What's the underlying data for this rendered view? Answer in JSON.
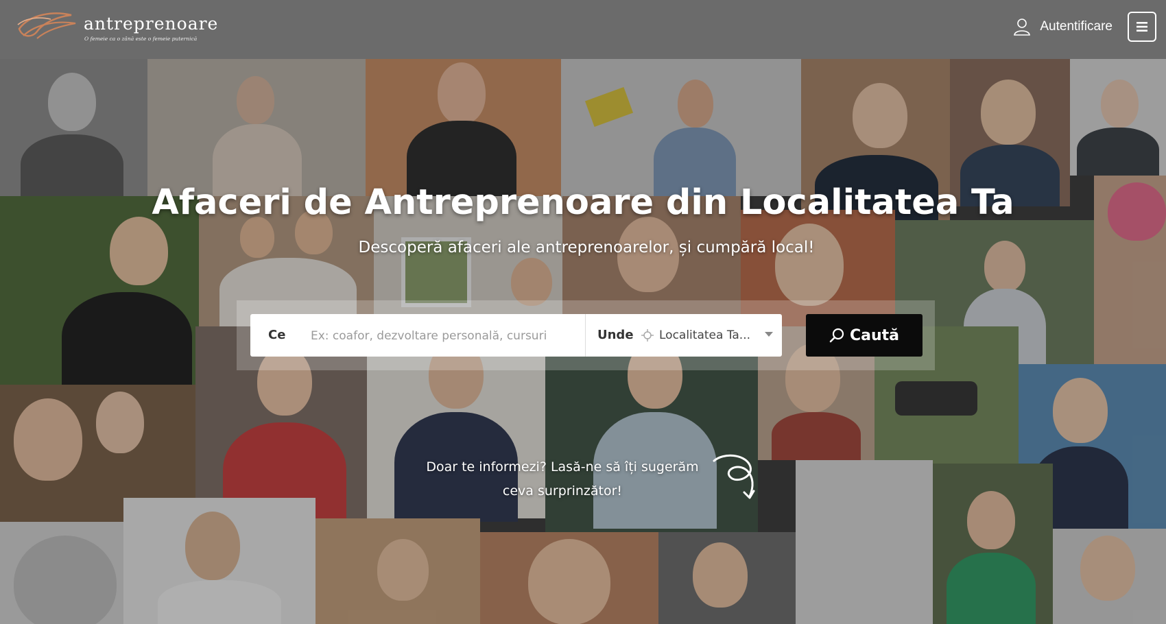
{
  "header": {
    "logo_text": "antreprenoare",
    "logo_tagline": "O femeie ca o zână este o femeie puternică",
    "login_label": "Autentificare"
  },
  "hero": {
    "title": "Afaceri de Antreprenoare din Localitatea Ta",
    "subtitle": "Descoperă afaceri ale antreprenoarelor, și cumpără local!"
  },
  "search": {
    "what_label": "Ce",
    "what_placeholder": "Ex: coafor, dezvoltare personală, cursuri",
    "where_label": "Unde",
    "where_value": "Localitatea Ta...",
    "button_label": "Caută"
  },
  "suggest": {
    "line1": "Doar te informezi? Lasă-ne să îți sugerăm",
    "line2": "ceva surprinzător!"
  },
  "colors": {
    "header_bg": "#6b6b6b",
    "button_bg": "#0b0b0b"
  },
  "icons": [
    "logo-swirl-icon",
    "user-icon",
    "hamburger-menu-icon",
    "location-crosshair-icon",
    "caret-down-icon",
    "search-icon",
    "curly-arrow-icon"
  ]
}
